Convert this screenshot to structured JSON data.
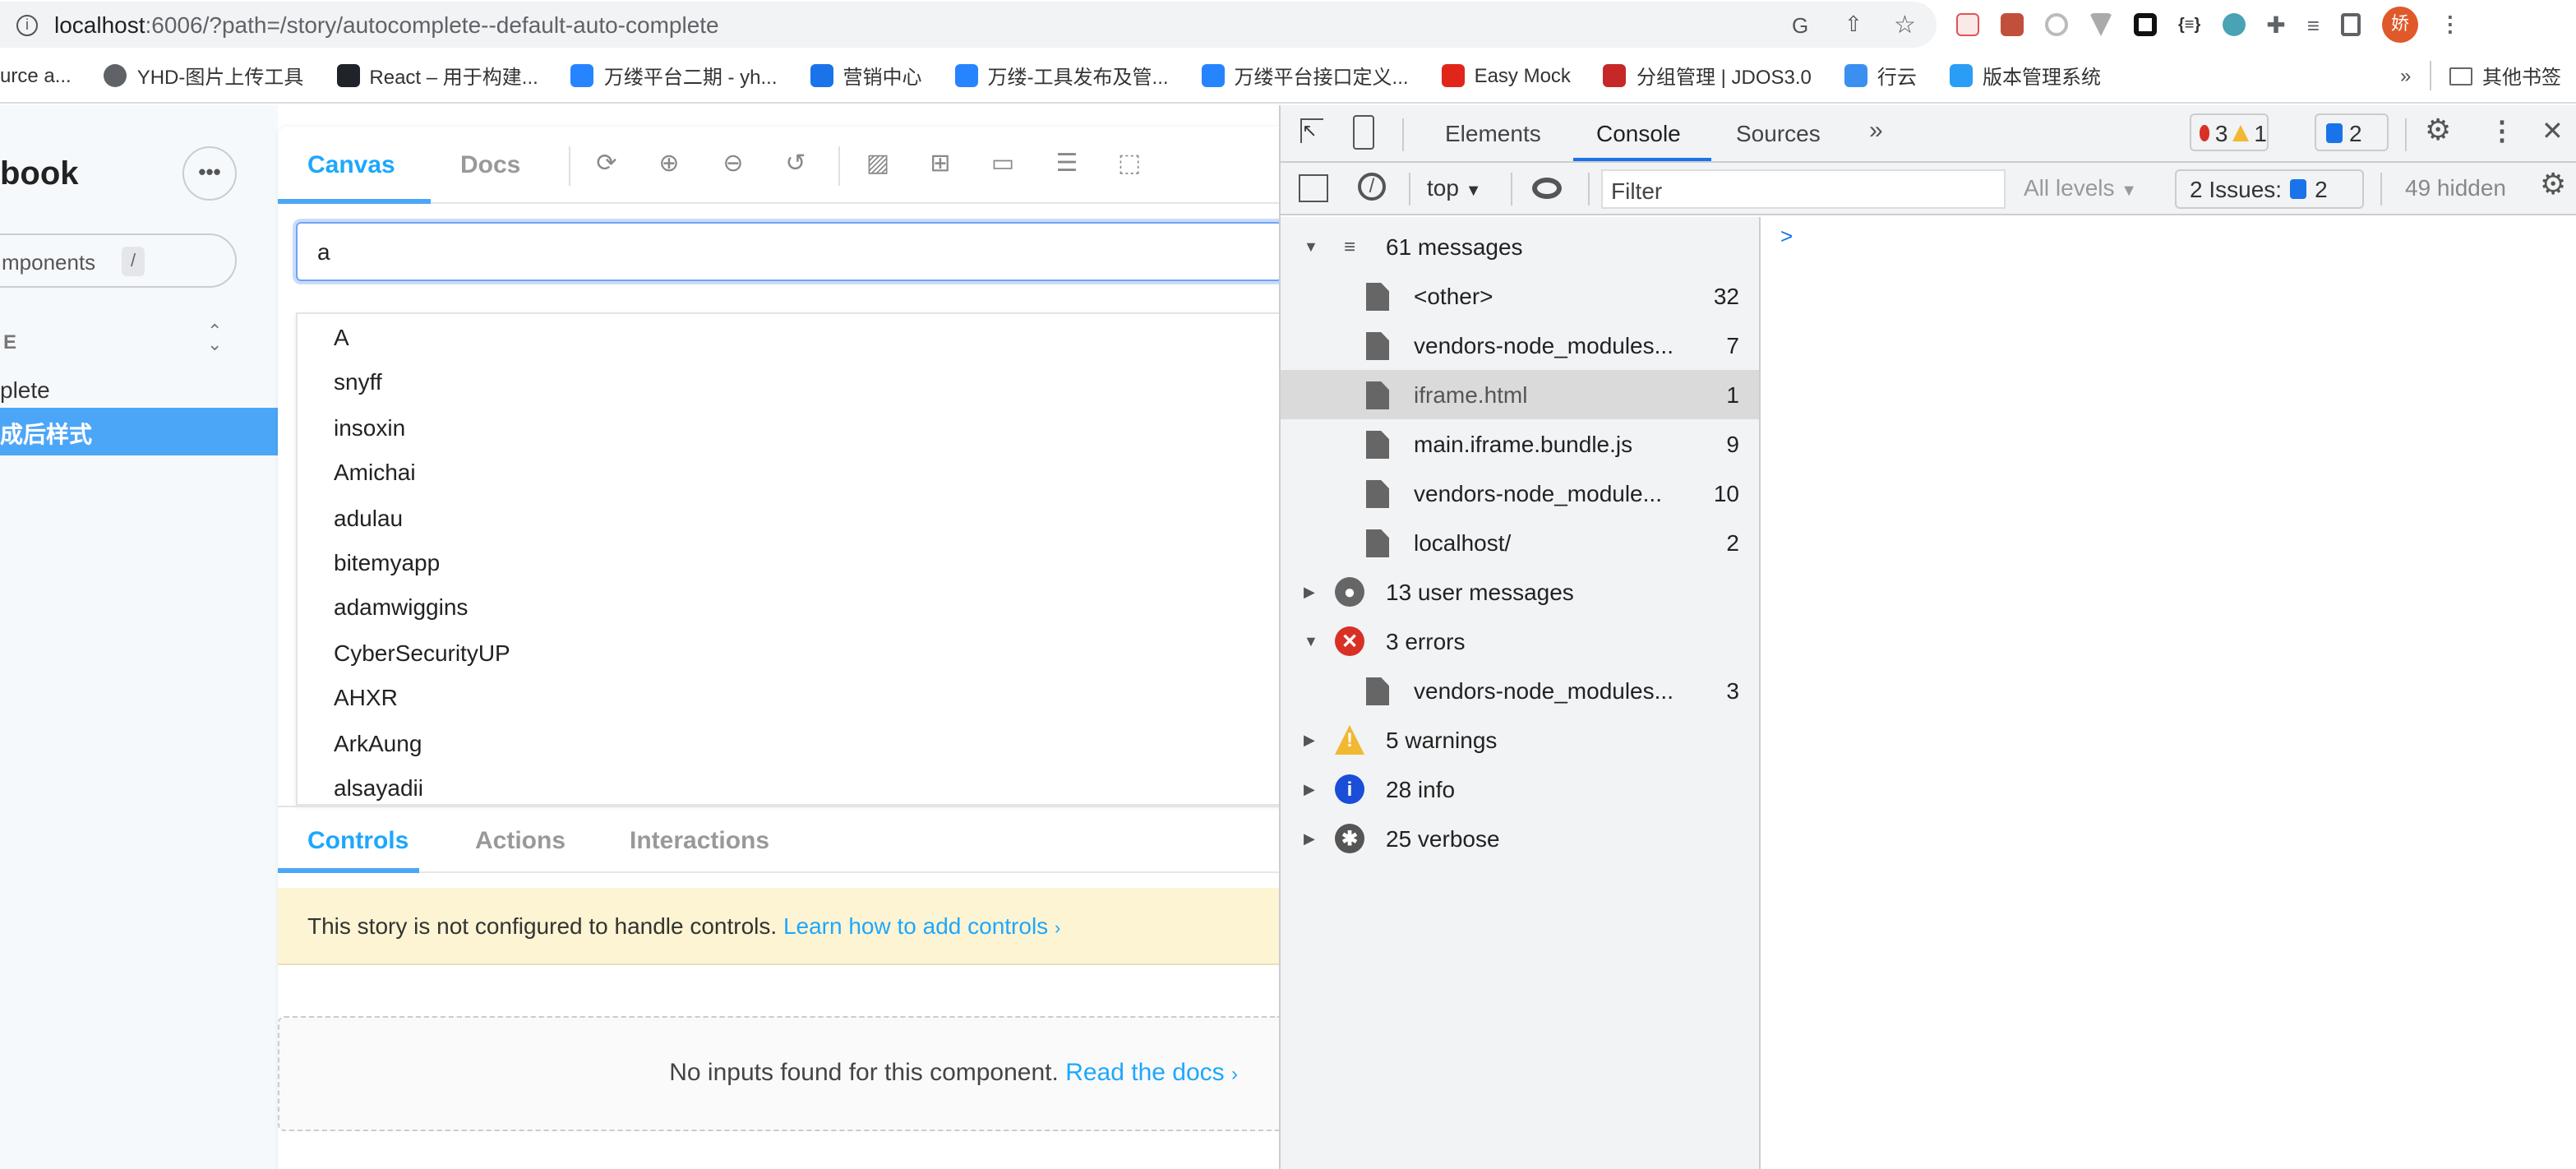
{
  "browser": {
    "url_host": "localhost",
    "url_rest": ":6006/?path=/story/autocomplete--default-auto-complete",
    "avatar_text": "娇",
    "bookmarks": [
      {
        "label": "urce a...",
        "icon": "page-icon",
        "color": "#ffffff"
      },
      {
        "label": "YHD-图片上传工具",
        "icon": "globe-icon",
        "color": "#5f6368"
      },
      {
        "label": "React – 用于构建...",
        "icon": "react-icon",
        "color": "#20232a"
      },
      {
        "label": "万缕平台二期 - yh...",
        "icon": "confluence-icon",
        "color": "#2684ff"
      },
      {
        "label": "营销中心",
        "icon": "m-logo-icon",
        "color": "#1a73e8"
      },
      {
        "label": "万缕-工具发布及管...",
        "icon": "confluence-icon",
        "color": "#2684ff"
      },
      {
        "label": "万缕平台接口定义...",
        "icon": "confluence-icon",
        "color": "#2684ff"
      },
      {
        "label": "Easy Mock",
        "icon": "jd-icon",
        "color": "#e1251b"
      },
      {
        "label": "分组管理 | JDOS3.0",
        "icon": "tig-icon",
        "color": "#c62828"
      },
      {
        "label": "行云",
        "icon": "cloud-icon",
        "color": "#3b8ff0"
      },
      {
        "label": "版本管理系统",
        "icon": "vms-icon",
        "color": "#2a9df4"
      }
    ],
    "more_label": "»",
    "other_bookmarks": "其他书签"
  },
  "storybook": {
    "brand": "book",
    "search_placeholder": "mponents",
    "search_shortcut": "/",
    "section_label": "E",
    "nav_items": [
      {
        "label": "plete",
        "active": false
      },
      {
        "label": "成后样式",
        "active": true
      }
    ],
    "tabs": [
      {
        "label": "Canvas",
        "active": true
      },
      {
        "label": "Docs",
        "active": false
      }
    ],
    "input_value": "a",
    "options": [
      "A",
      "snyff",
      "insoxin",
      "Amichai",
      "adulau",
      "bitemyapp",
      "adamwiggins",
      "CyberSecurityUP",
      "AHXR",
      "ArkAung",
      "alsayadii"
    ],
    "addon_tabs": [
      {
        "label": "Controls",
        "active": true
      },
      {
        "label": "Actions",
        "active": false
      },
      {
        "label": "Interactions",
        "active": false
      }
    ],
    "banner_text": "This story is not configured to handle controls.",
    "banner_link": "Learn how to add controls",
    "empty_text": "No inputs found for this component.",
    "empty_link": "Read the docs",
    "accent": "#1ea7fd"
  },
  "devtools": {
    "tabs": [
      {
        "label": "Elements",
        "active": false
      },
      {
        "label": "Console",
        "active": true
      },
      {
        "label": "Sources",
        "active": false
      }
    ],
    "more": "»",
    "error_count": "3",
    "warning_count": "1",
    "issue_count": "2",
    "context": "top",
    "filter_placeholder": "Filter",
    "levels": "All levels",
    "issues_label": "2 Issues:",
    "issues_count": "2",
    "hidden": "49 hidden",
    "prompt": ">",
    "groups": [
      {
        "label": "61 messages",
        "icon": "list-icon",
        "expanded": true,
        "children": [
          {
            "label": "<other>",
            "count": "32"
          },
          {
            "label": "vendors-node_modules...",
            "count": "7"
          },
          {
            "label": "iframe.html",
            "count": "1",
            "selected": true
          },
          {
            "label": "main.iframe.bundle.js",
            "count": "9"
          },
          {
            "label": "vendors-node_module...",
            "count": "10"
          },
          {
            "label": "localhost/",
            "count": "2"
          }
        ]
      },
      {
        "label": "13 user messages",
        "icon": "user-icon",
        "expanded": false
      },
      {
        "label": "3 errors",
        "icon": "error-icon",
        "expanded": true,
        "children": [
          {
            "label": "vendors-node_modules...",
            "count": "3"
          }
        ]
      },
      {
        "label": "5 warnings",
        "icon": "warning-icon",
        "expanded": false
      },
      {
        "label": "28 info",
        "icon": "info-icon",
        "expanded": false
      },
      {
        "label": "25 verbose",
        "icon": "bug-icon",
        "expanded": false
      }
    ]
  }
}
